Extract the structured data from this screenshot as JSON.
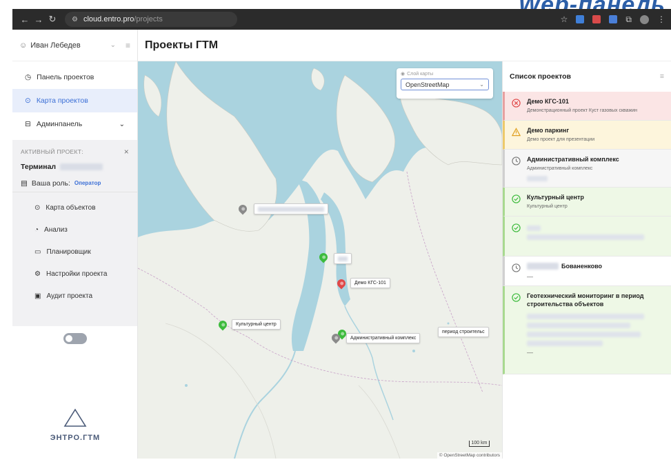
{
  "corner_heading": "Web-панель",
  "browser": {
    "url_host": "cloud.entro.pro",
    "url_path": "/projects",
    "icons": [
      "back-icon",
      "forward-icon",
      "reload-icon",
      "site-settings-icon",
      "star-icon",
      "extension-icons",
      "profile-icon",
      "kebab-icon"
    ]
  },
  "sidebar": {
    "user_name": "Иван Лебедев",
    "nav": [
      {
        "label": "Панель проектов",
        "icon": "dashboard-icon"
      },
      {
        "label": "Карта проектов",
        "icon": "map-pin-icon",
        "active": true
      },
      {
        "label": "Админпанель",
        "icon": "lock-icon"
      }
    ],
    "active_project_title": "АКТИВНЫЙ ПРОЕКТ:",
    "active_project_name": "Терминал",
    "role_label": "Ваша роль:",
    "role_value": "Оператор",
    "sub_items": [
      {
        "label": "Карта объектов",
        "icon": "map-pin-icon"
      },
      {
        "label": "Анализ",
        "icon": "chart-icon"
      },
      {
        "label": "Планировщик",
        "icon": "calendar-icon"
      },
      {
        "label": "Настройки проекта",
        "icon": "gear-icon"
      },
      {
        "label": "Аудит проекта",
        "icon": "document-icon"
      }
    ],
    "logo_text": "ЭНТРО.ГТМ"
  },
  "header": {
    "title": "Проекты ГТМ"
  },
  "map": {
    "layer_label": "Слой карты",
    "layer_value": "OpenStreetMap",
    "markers": [
      {
        "label": "Демо КГС-101",
        "status": "red"
      },
      {
        "label": "Культурный центр",
        "status": "green"
      },
      {
        "label": "Административный комплекс",
        "status": "grey"
      },
      {
        "label": "период строительс",
        "status": "green"
      }
    ],
    "scale": "100 km",
    "attribution": "© OpenStreetMap contributors"
  },
  "project_list": {
    "title": "Список проектов",
    "items": [
      {
        "title": "Демо КГС-101",
        "desc": "Демонстрационный проект Куст газовых скважин",
        "status": "red"
      },
      {
        "title": "Демо паркинг",
        "desc": "Демо проект для презентации",
        "status": "yellow"
      },
      {
        "title": "Административный комплекс",
        "desc": "Административный комплекс",
        "status": "grey"
      },
      {
        "title": "Культурный центр",
        "desc": "Культурный центр",
        "status": "green"
      },
      {
        "title": "",
        "desc": "",
        "status": "green"
      },
      {
        "title": "Бованенково",
        "desc": "—",
        "status": "white"
      },
      {
        "title": "Геотехнический мониторинг в период строительства объектов",
        "desc": "—",
        "status": "green"
      }
    ]
  },
  "colors": {
    "accent": "#3b6fd6",
    "red": "#e04848",
    "green": "#3dbb3d",
    "grey": "#8a8a8a"
  }
}
